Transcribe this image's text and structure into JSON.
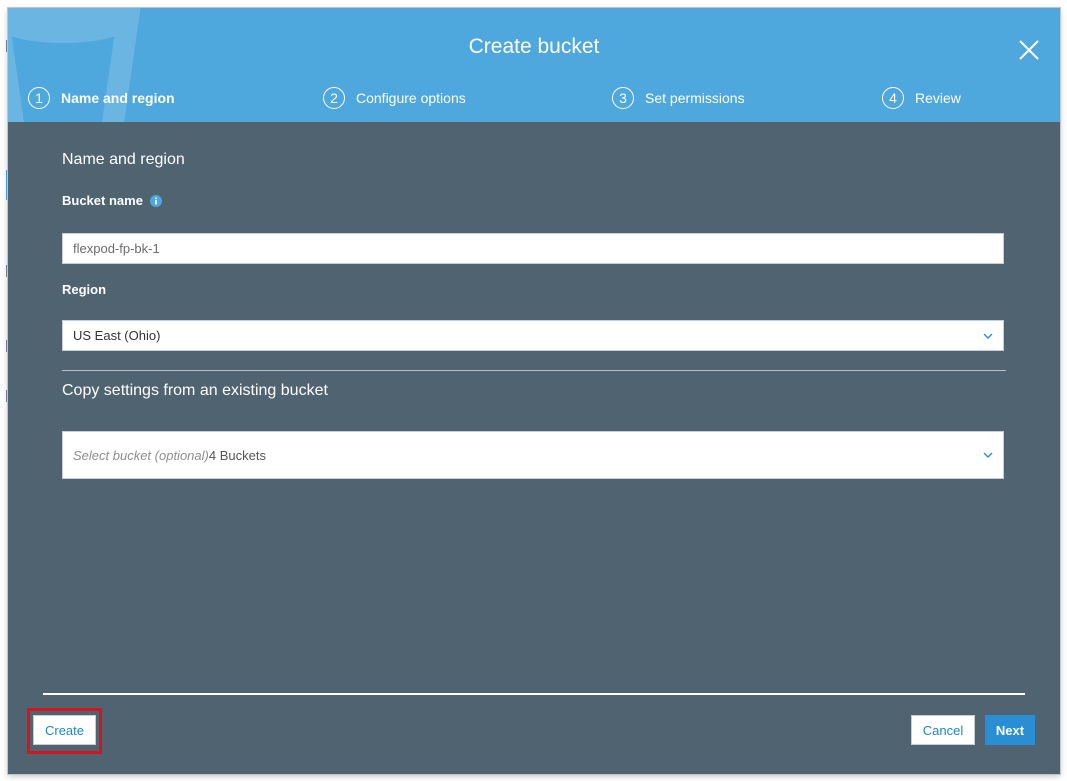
{
  "dialog": {
    "title": "Create bucket",
    "close_icon": "close-icon"
  },
  "steps": [
    {
      "number": "1",
      "label": "Name and region",
      "active": true
    },
    {
      "number": "2",
      "label": "Configure options",
      "active": false
    },
    {
      "number": "3",
      "label": "Set permissions",
      "active": false
    },
    {
      "number": "4",
      "label": "Review",
      "active": false
    }
  ],
  "name_region": {
    "section_title": "Name and region",
    "bucket_name_label": "Bucket name",
    "bucket_name_info_icon": "info-icon",
    "bucket_name_value": "flexpod-fp-bk-1",
    "region_label": "Region",
    "region_value": "US East (Ohio)"
  },
  "copy_settings": {
    "section_title": "Copy settings from an existing bucket",
    "select_placeholder": "Select bucket (optional)",
    "select_count": "4 Buckets"
  },
  "footer": {
    "create_label": "Create",
    "cancel_label": "Cancel",
    "next_label": "Next"
  },
  "colors": {
    "header_bg": "#4ea7dd",
    "body_bg": "#4f6370",
    "primary_button": "#2a8ed4",
    "highlight_border": "#d9131b"
  }
}
